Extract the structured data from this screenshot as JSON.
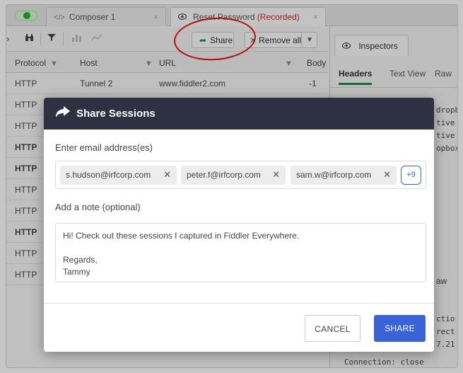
{
  "tabs": [
    {
      "icon": "</>",
      "label": "Composer 1",
      "close": "×"
    },
    {
      "icon": "eye-icon",
      "label": "Reset Password",
      "suffix": "(Recorded)",
      "close": "×"
    }
  ],
  "toolbar": {
    "share_label": "Share",
    "remove_all_label": "Remove all"
  },
  "grid": {
    "columns": [
      "Protocol",
      "Host",
      "URL",
      "Body"
    ],
    "rows": [
      {
        "protocol": "HTTP",
        "host": "Tunnel 2",
        "url": "www.fiddler2.com",
        "body": "-1"
      },
      {
        "protocol": "HTTP"
      },
      {
        "protocol": "HTTP"
      },
      {
        "protocol": "HTTP"
      },
      {
        "protocol": "HTTP"
      },
      {
        "protocol": "HTTP"
      },
      {
        "protocol": "HTTP"
      },
      {
        "protocol": "HTTP"
      },
      {
        "protocol": "HTTP"
      },
      {
        "protocol": "HTTP"
      }
    ]
  },
  "inspectors": {
    "tab_label": "Inspectors",
    "subtabs": [
      "Headers",
      "Text View",
      "Raw"
    ],
    "peek_text": [
      "dropb",
      "tive",
      "tive",
      "opbox"
    ],
    "lower_tab_peek": "aw",
    "lower_text": [
      "ctio",
      "rect",
      "7.21"
    ],
    "bottom_line": "Connection: close"
  },
  "dialog": {
    "title": "Share Sessions",
    "email_label": "Enter email address(es)",
    "emails": [
      "s.hudson@irfcorp.com",
      "peter.f@irfcorp.com",
      "sam.w@irfcorp.com"
    ],
    "more_count": "+9",
    "note_label": "Add a note (optional)",
    "note_lines": [
      "Hi! Check out these sessions I captured in Fiddler Everywhere.",
      "",
      "Regards,",
      "Tammy"
    ],
    "cancel_label": "CANCEL",
    "share_label": "SHARE"
  },
  "colors": {
    "dialog_header": "#2d3142",
    "primary": "#3b63d9",
    "annotation": "#ee1111",
    "accent_green": "#1a8c43"
  }
}
